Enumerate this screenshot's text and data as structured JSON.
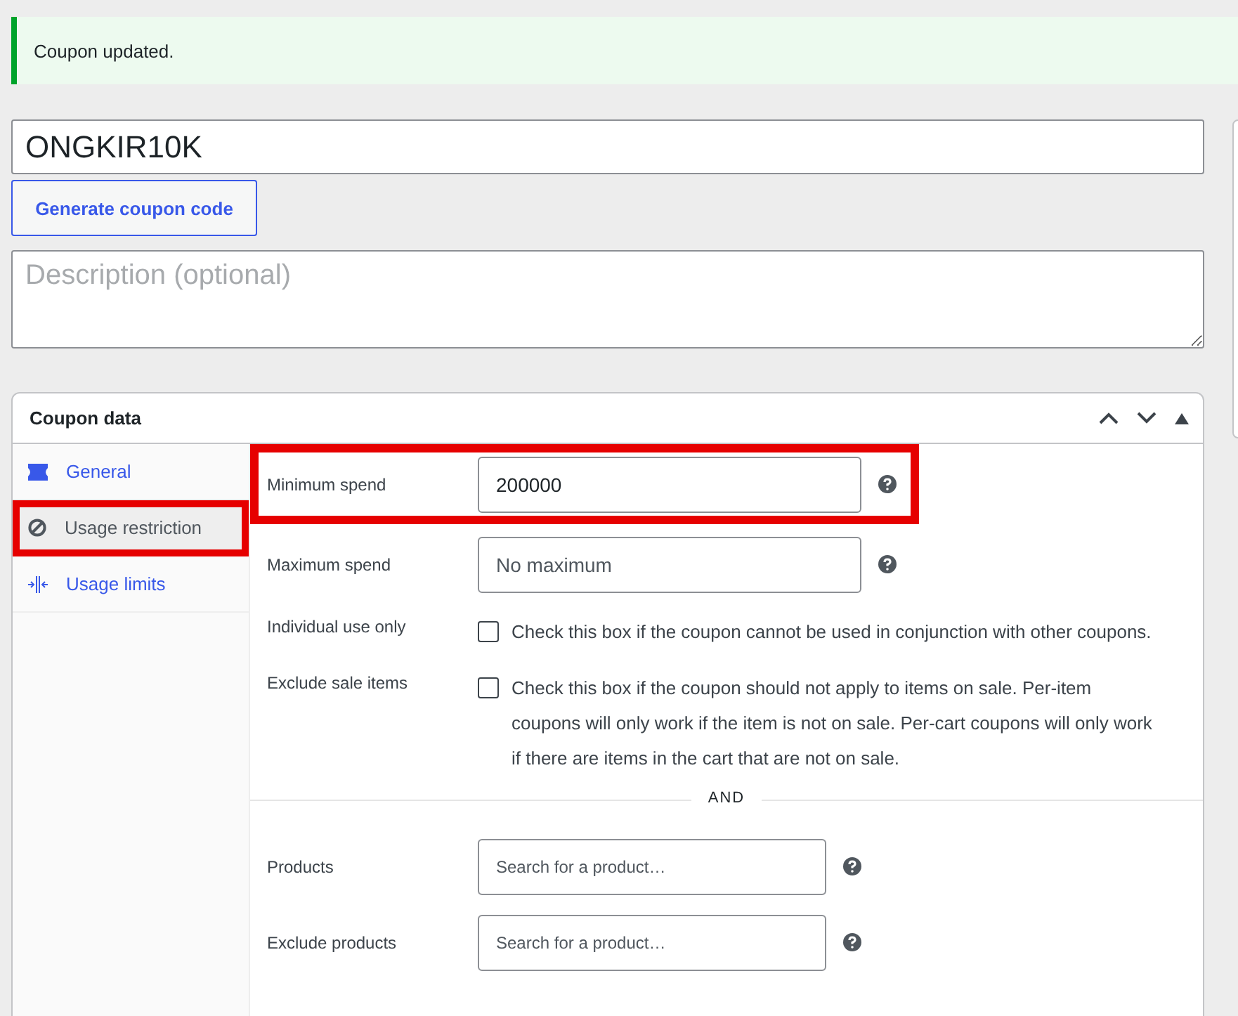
{
  "notice": {
    "text": "Coupon updated."
  },
  "coupon_code": {
    "value": "ONGKIR10K"
  },
  "generate_button": {
    "label": "Generate coupon code"
  },
  "description": {
    "placeholder": "Description (optional)"
  },
  "coupon_data": {
    "title": "Coupon data",
    "tabs": [
      {
        "label": "General",
        "kind": "ticket",
        "selected": false,
        "highlighted": false
      },
      {
        "label": "Usage restriction",
        "kind": "restrict",
        "selected": true,
        "highlighted": true
      },
      {
        "label": "Usage limits",
        "kind": "limits",
        "selected": false,
        "highlighted": false
      }
    ],
    "fields": [
      {
        "kind": "input",
        "label": "Minimum spend",
        "value": "200000",
        "highlighted": true
      },
      {
        "kind": "input",
        "label": "Maximum spend",
        "placeholder": "No maximum",
        "highlighted": false
      },
      {
        "kind": "checkbox",
        "label": "Individual use only",
        "checked": false,
        "text": "Check this box if the coupon cannot be used in conjunction with other coupons."
      },
      {
        "kind": "checkbox",
        "label": "Exclude sale items",
        "checked": false,
        "text": "Check this box if the coupon should not apply to items on sale. Per-item coupons will only work if the item is not on sale. Per-cart coupons will only work if there are items in the cart that are not on sale."
      },
      {
        "kind": "divider",
        "text": "AND"
      },
      {
        "kind": "search",
        "label": "Products",
        "placeholder": "Search for a product…"
      },
      {
        "kind": "search",
        "label": "Exclude products",
        "placeholder": "Search for a product…"
      }
    ]
  }
}
